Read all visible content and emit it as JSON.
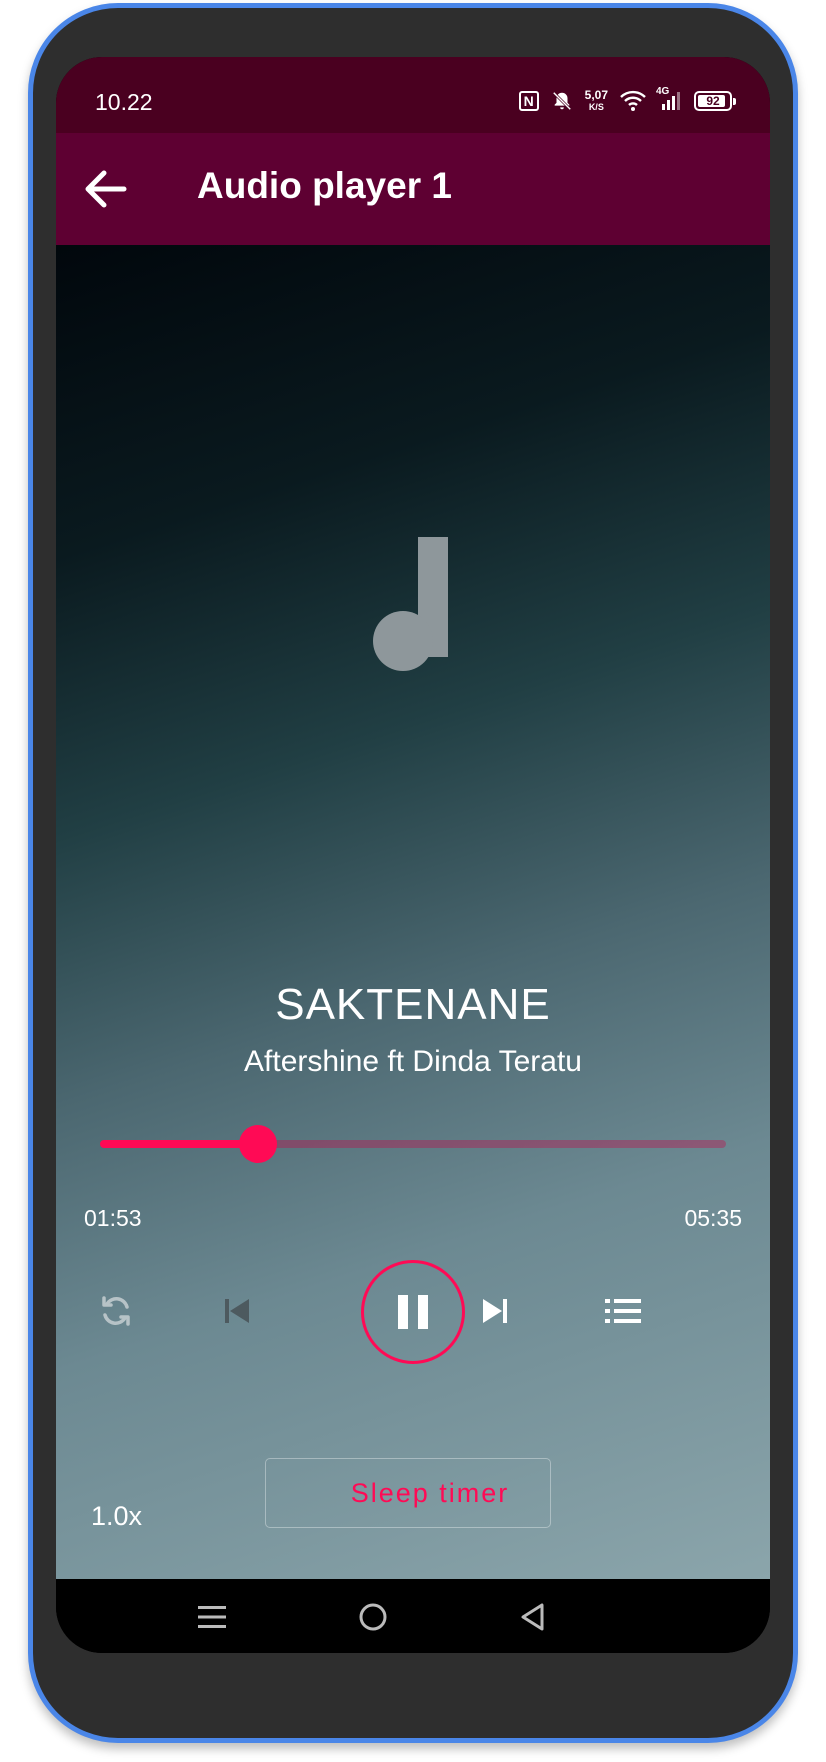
{
  "status_bar": {
    "time": "10.22",
    "net_speed_value": "5,07",
    "net_speed_unit": "K/S",
    "network_type": "4G",
    "battery_level": "92",
    "battery_fraction": 0.92
  },
  "app_bar": {
    "title": "Audio player 1",
    "back_icon": "arrow-left-icon"
  },
  "track": {
    "title": "SAKTENANE",
    "artist": "Aftershine ft Dinda Teratu",
    "elapsed": "01:53",
    "duration": "05:35",
    "progress_fraction": 0.253
  },
  "controls": {
    "repeat_icon": "repeat-icon",
    "previous_icon": "skip-previous-icon",
    "play_pause_icon": "pause-icon",
    "next_icon": "skip-next-icon",
    "playlist_icon": "playlist-icon"
  },
  "bottom": {
    "speed": "1.0x",
    "sleep_timer_label": "Sleep timer"
  },
  "colors": {
    "accent": "#ff0a55",
    "app_bar": "#5e0032",
    "status_bar": "#4a0020"
  }
}
